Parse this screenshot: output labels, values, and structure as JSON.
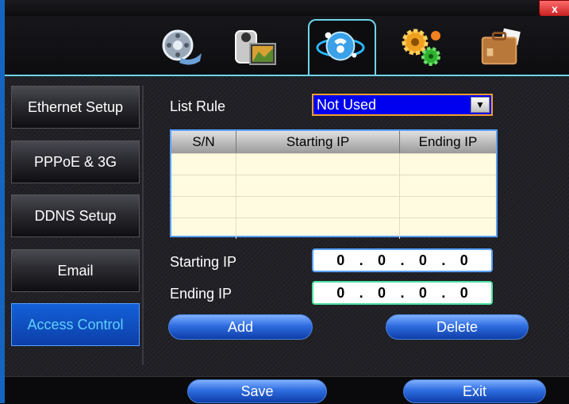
{
  "window": {
    "close_label": "x"
  },
  "toolbar_icons": [
    "film-icon",
    "camera-icon",
    "network-globe-icon",
    "gears-icon",
    "briefcase-icon"
  ],
  "sidebar": {
    "items": [
      {
        "label": "Ethernet Setup",
        "active": false
      },
      {
        "label": "PPPoE & 3G",
        "active": false
      },
      {
        "label": "DDNS Setup",
        "active": false
      },
      {
        "label": "Email",
        "active": false
      },
      {
        "label": "Access Control",
        "active": true
      }
    ]
  },
  "form": {
    "list_rule_label": "List Rule",
    "list_rule_value": "Not Used",
    "table": {
      "headers": [
        "S/N",
        "Starting IP",
        "Ending IP"
      ],
      "rows": [
        [
          "",
          "",
          ""
        ],
        [
          "",
          "",
          ""
        ],
        [
          "",
          "",
          ""
        ],
        [
          "",
          "",
          ""
        ]
      ]
    },
    "starting_ip_label": "Starting IP",
    "starting_ip": [
      "0",
      "0",
      "0",
      "0"
    ],
    "ending_ip_label": "Ending IP",
    "ending_ip": [
      "0",
      "0",
      "0",
      "0"
    ],
    "add_label": "Add",
    "delete_label": "Delete"
  },
  "footer": {
    "save_label": "Save",
    "exit_label": "Exit"
  },
  "colors": {
    "accent": "#1565c0",
    "select_bg": "#0000f0",
    "active_tab": "#6fd5e8"
  }
}
